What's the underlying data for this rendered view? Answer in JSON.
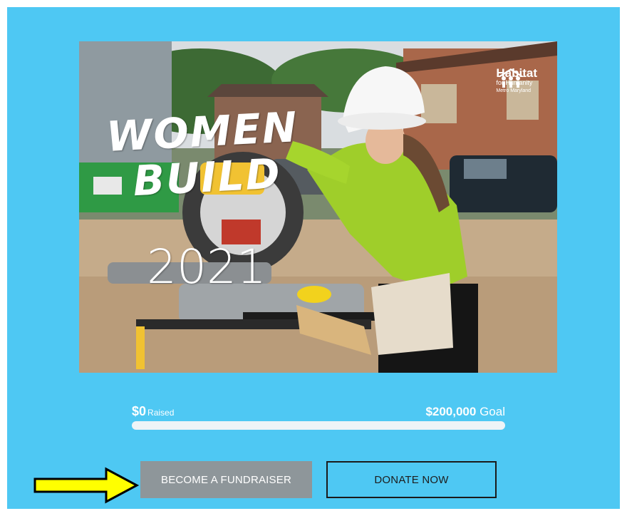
{
  "hero": {
    "title_line1": "WOMEN",
    "title_line2": "BUILD",
    "year": "2021",
    "logo": {
      "name": "Habitat",
      "sub": "for Humanity",
      "location": "Metro Maryland"
    }
  },
  "progress": {
    "raised_amount": "$0",
    "raised_label": "Raised",
    "goal_amount": "$200,000",
    "goal_label": "Goal",
    "fraction": 0
  },
  "buttons": {
    "become_fundraiser": "BECOME A FUNDRAISER",
    "donate_now": "DONATE NOW"
  },
  "colors": {
    "panel_bg": "#4ec8f3",
    "fundraiser_button_bg": "#8e969a",
    "arrow_fill": "#ffff00"
  },
  "annotation": {
    "pointer": "arrow-pointing-to-become-fundraiser"
  }
}
